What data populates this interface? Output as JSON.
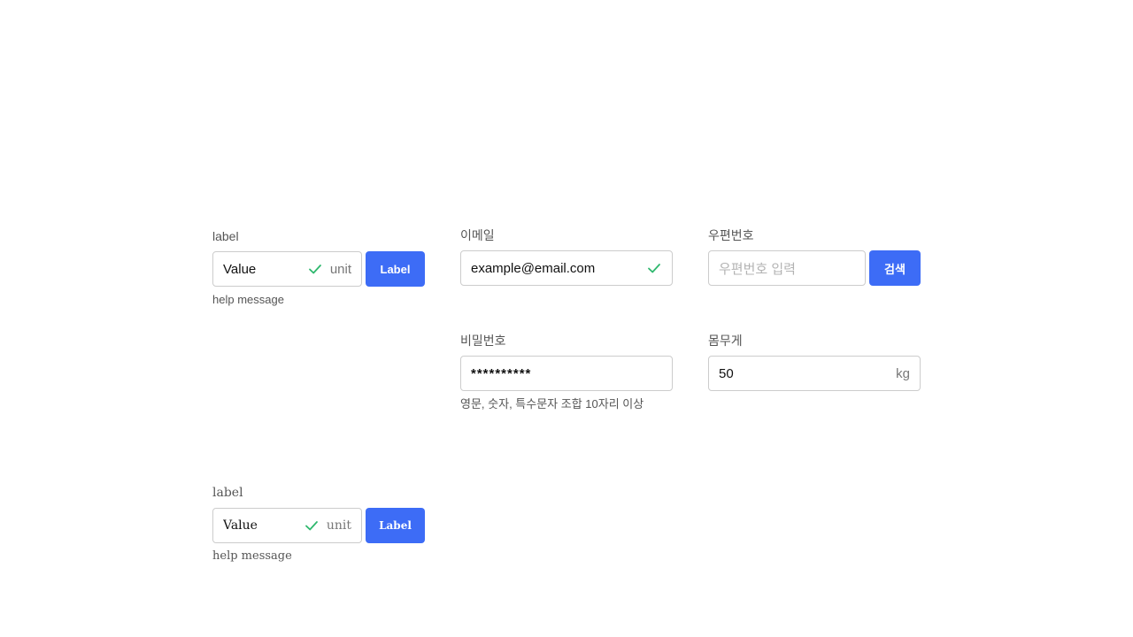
{
  "field_top": {
    "label": "label",
    "value": "Value",
    "unit": "unit",
    "button_label": "Label",
    "help": "help message"
  },
  "email": {
    "label": "이메일",
    "value": "example@email.com"
  },
  "postcode": {
    "label": "우편번호",
    "placeholder": "우편번호 입력",
    "button_label": "검색"
  },
  "password": {
    "label": "비밀번호",
    "value": "**********",
    "help": "영문, 숫자, 특수문자 조합 10자리 이상"
  },
  "weight": {
    "label": "몸무게",
    "value": "50",
    "unit": "kg"
  },
  "field_bottom": {
    "label": "label",
    "value": "Value",
    "unit": "unit",
    "button_label": "Label",
    "help": "help message"
  },
  "colors": {
    "accent": "#3d6cf6",
    "success": "#2fb86e",
    "border": "#cccccc"
  },
  "icons": {
    "valid": "check-icon"
  }
}
